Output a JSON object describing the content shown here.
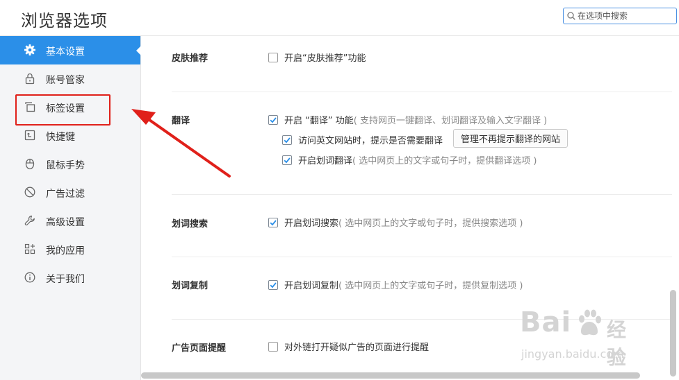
{
  "header": {
    "title": "浏览器选项",
    "search_placeholder": "在选项中搜索"
  },
  "sidebar": {
    "items": [
      {
        "label": "基本设置",
        "icon": "gear-icon",
        "active": true
      },
      {
        "label": "账号管家",
        "icon": "lock-icon"
      },
      {
        "label": "标签设置",
        "icon": "tabs-icon"
      },
      {
        "label": "快捷键",
        "icon": "keyboard-icon"
      },
      {
        "label": "鼠标手势",
        "icon": "mouse-icon"
      },
      {
        "label": "广告过滤",
        "icon": "block-icon"
      },
      {
        "label": "高级设置",
        "icon": "wrench-icon"
      },
      {
        "label": "我的应用",
        "icon": "apps-icon"
      },
      {
        "label": "关于我们",
        "icon": "info-icon"
      }
    ]
  },
  "sections": {
    "skin": {
      "title": "皮肤推荐",
      "option": {
        "label": "开启“皮肤推荐”功能",
        "checked": false
      }
    },
    "translate": {
      "title": "翻译",
      "main": {
        "label": "开启 “翻译” 功能",
        "hint": "( 支持网页一键翻译、划词翻译及输入文字翻译 )",
        "checked": true
      },
      "sub1": {
        "label": "访问英文网站时，提示是否需要翻译",
        "checked": true
      },
      "manage_button": "管理不再提示翻译的网站",
      "sub2": {
        "label": "开启划词翻译",
        "hint": "( 选中网页上的文字或句子时，提供翻译选项 )",
        "checked": true
      }
    },
    "search": {
      "title": "划词搜索",
      "option": {
        "label": "开启划词搜索",
        "hint": "( 选中网页上的文字或句子时，提供搜索选项 )",
        "checked": true
      }
    },
    "copy": {
      "title": "划词复制",
      "option": {
        "label": "开启划词复制",
        "hint": "( 选中网页上的文字或句子时，提供复制选项 )",
        "checked": true
      }
    },
    "ad": {
      "title": "广告页面提醒",
      "option": {
        "label": "对外链打开疑似广告的页面进行提醒",
        "checked": false
      }
    }
  },
  "watermark": {
    "brand": "Bai",
    "brand2": "经验",
    "url": "jingyan.baidu.com"
  },
  "colors": {
    "accent": "#2b8fe8",
    "annotation_red": "#e0201a"
  }
}
